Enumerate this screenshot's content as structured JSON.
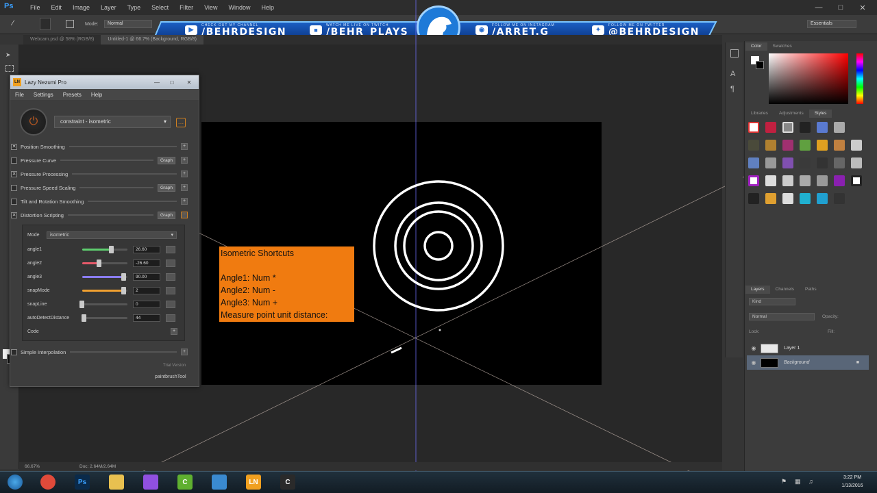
{
  "menubar": {
    "logo": "Ps",
    "items": [
      "File",
      "Edit",
      "Image",
      "Layer",
      "Type",
      "Select",
      "Filter",
      "View",
      "Window",
      "Help"
    ]
  },
  "options": {
    "mode_label": "Mode:",
    "mode_value": "Normal",
    "workspace": "Essentials"
  },
  "banner": {
    "items": [
      {
        "small": "CHECK OUT MY CHANNEL",
        "big": "/BEHRDESIGN",
        "icon": "youtube-icon"
      },
      {
        "small": "WATCH ME LIVE ON TWITCH",
        "big": "/BEHR_PLAYS",
        "icon": "twitch-icon"
      },
      {
        "small": "FOLLOW ME ON INSTAGRAM",
        "big": "/ARRET.G",
        "icon": "instagram-icon"
      },
      {
        "small": "FOLLOW ME ON TWITTER",
        "big": "@BEHRDESIGN",
        "icon": "twitter-icon"
      }
    ]
  },
  "tabs": [
    "Webcam.psd @ 58% (RGB/8)",
    "Untitled-1 @ 66.7% (Background, RGB/8)"
  ],
  "note": {
    "lines": [
      "Isometric Shortcuts",
      "",
      "Angle1: Num *",
      "Angle2: Num -",
      "Angle3: Num +",
      "Measure point unit distance:"
    ]
  },
  "lazy_nezumi": {
    "title": "Lazy Nezumi Pro",
    "menu": [
      "File",
      "Settings",
      "Presets",
      "Help"
    ],
    "preset": "constraint - isometric",
    "options": [
      {
        "label": "Position Smoothing",
        "checked": true,
        "graph": false
      },
      {
        "label": "Pressure Curve",
        "checked": false,
        "graph": true
      },
      {
        "label": "Pressure Processing",
        "checked": true,
        "graph": false
      },
      {
        "label": "Pressure Speed Scaling",
        "checked": false,
        "graph": true
      },
      {
        "label": "Tilt and Rotation Smoothing",
        "checked": false,
        "graph": false
      },
      {
        "label": "Distortion Scripting",
        "checked": true,
        "graph": true
      }
    ],
    "graph_label": "Graph",
    "mode_label": "Mode",
    "mode_value": "isometric",
    "params": [
      {
        "label": "angle1",
        "value": "26.60",
        "level": 0.65,
        "color": "#5fcf6f"
      },
      {
        "label": "angle2",
        "value": "-26.60",
        "level": 0.38,
        "color": "#e85a6a"
      },
      {
        "label": "angle3",
        "value": "90.00",
        "level": 0.92,
        "color": "#8a7cf0"
      },
      {
        "label": "snapMode",
        "value": "2",
        "level": 0.92,
        "color": "#f0a030"
      },
      {
        "label": "snapLine",
        "value": "0",
        "level": 0.0,
        "color": "#777777"
      },
      {
        "label": "autoDetectDistance",
        "value": "44",
        "level": 0.05,
        "color": "#777777"
      }
    ],
    "code_label": "Code",
    "simple_interp": "Simple Interpolation",
    "trial": "Trial Version",
    "target": "paintbrushTool"
  },
  "right": {
    "color_tabs": [
      "Color",
      "Swatches"
    ],
    "style_tabs": [
      "Libraries",
      "Adjustments",
      "Styles"
    ],
    "layer_tabs": [
      "Layers",
      "Channels",
      "Paths"
    ],
    "kind": "Kind",
    "blend": "Normal",
    "opacity_label": "Opacity:",
    "lock_label": "Lock:",
    "fill_label": "Fill:",
    "layers": [
      {
        "name": "Layer 1",
        "selected": false
      },
      {
        "name": "Background",
        "selected": true
      }
    ]
  },
  "status": {
    "zoom": "66.67%",
    "doc": "Doc: 2.64M/2.64M"
  },
  "taskbar": {
    "apps": [
      {
        "name": "chrome",
        "label": "",
        "color": "#e04a3a"
      },
      {
        "name": "photoshop",
        "label": "Ps",
        "color": "#0a2a4a"
      },
      {
        "name": "explorer",
        "label": "",
        "color": "#e8c050"
      },
      {
        "name": "feather",
        "label": "",
        "color": "#9050e0"
      },
      {
        "name": "camtasia",
        "label": "C",
        "color": "#5fb030"
      },
      {
        "name": "app-blue",
        "label": "",
        "color": "#3a8ad0"
      },
      {
        "name": "lazy-nezumi",
        "label": "LN",
        "color": "#f0a020"
      },
      {
        "name": "camtasia-recorder",
        "label": "C",
        "color": "#2a2a2a"
      }
    ],
    "time": "3:22 PM",
    "date": "1/13/2016"
  }
}
